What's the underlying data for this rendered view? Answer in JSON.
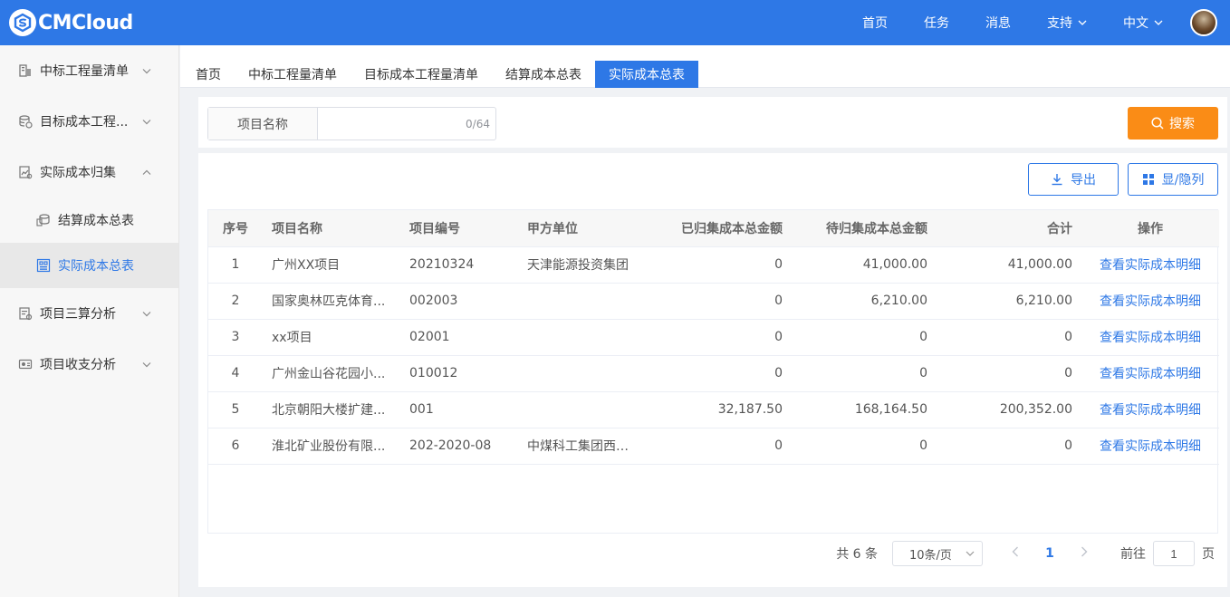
{
  "app": {
    "title": "CMCloud"
  },
  "colors": {
    "primary": "#2e78e6",
    "accent": "#fa8c16",
    "header_bg": "#2e78e6"
  },
  "topnav": {
    "home": "首页",
    "tasks": "任务",
    "messages": "消息",
    "support": "支持",
    "language": "中文"
  },
  "sidebar": {
    "items": [
      {
        "label": "中标工程量清单",
        "icon": "building-icon",
        "expanded": false
      },
      {
        "label": "目标成本工程...",
        "icon": "database-icon",
        "expanded": false
      },
      {
        "label": "实际成本归集",
        "icon": "document-chart-icon",
        "expanded": true
      }
    ],
    "subitems": [
      {
        "label": "结算成本总表",
        "icon": "coins-icon",
        "active": false
      },
      {
        "label": "实际成本总表",
        "icon": "grid-report-icon",
        "active": true
      }
    ],
    "bottom_items": [
      {
        "label": "项目三算分析",
        "icon": "analysis-icon",
        "expanded": false
      },
      {
        "label": "项目收支分析",
        "icon": "wallet-icon",
        "expanded": false
      }
    ]
  },
  "tabs": [
    {
      "label": "首页",
      "active": false
    },
    {
      "label": "中标工程量清单",
      "active": false
    },
    {
      "label": "目标成本工程量清单",
      "active": false
    },
    {
      "label": "结算成本总表",
      "active": false
    },
    {
      "label": "实际成本总表",
      "active": true
    }
  ],
  "search": {
    "label": "项目名称",
    "value": "",
    "placeholder": "",
    "count": "0/64",
    "button": "搜索"
  },
  "toolbar": {
    "export": "导出",
    "toggle_columns": "显/隐列"
  },
  "table": {
    "headers": [
      "序号",
      "项目名称",
      "项目编号",
      "甲方单位",
      "已归集成本总金额",
      "待归集成本总金额",
      "合计",
      "操作"
    ],
    "rows": [
      {
        "no": "1",
        "name": "广州XX项目",
        "code": "20210324",
        "client": "天津能源投资集团",
        "collected": "0",
        "pending": "41,000.00",
        "total": "41,000.00",
        "action": "查看实际成本明细"
      },
      {
        "no": "2",
        "name": "国家奥林匹克体育...",
        "code": "002003",
        "client": "",
        "collected": "0",
        "pending": "6,210.00",
        "total": "6,210.00",
        "action": "查看实际成本明细"
      },
      {
        "no": "3",
        "name": "xx项目",
        "code": "02001",
        "client": "",
        "collected": "0",
        "pending": "0",
        "total": "0",
        "action": "查看实际成本明细"
      },
      {
        "no": "4",
        "name": "广州金山谷花园小...",
        "code": "010012",
        "client": "",
        "collected": "0",
        "pending": "0",
        "total": "0",
        "action": "查看实际成本明细"
      },
      {
        "no": "5",
        "name": "北京朝阳大楼扩建...",
        "code": "001",
        "client": "",
        "collected": "32,187.50",
        "pending": "168,164.50",
        "total": "200,352.00",
        "action": "查看实际成本明细"
      },
      {
        "no": "6",
        "name": "淮北矿业股份有限...",
        "code": "202-2020-08",
        "client": "中煤科工集团西安...",
        "collected": "0",
        "pending": "0",
        "total": "0",
        "action": "查看实际成本明细"
      }
    ]
  },
  "pagination": {
    "total": "共 6 条",
    "page_size": "10条/页",
    "current": "1",
    "goto_label": "前往",
    "goto_value": "1",
    "page_suffix": "页"
  }
}
